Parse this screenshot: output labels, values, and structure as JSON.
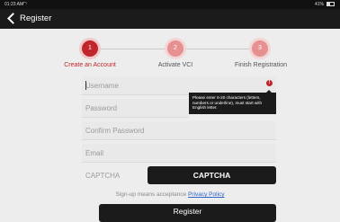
{
  "status_bar": {
    "time": "01:23 AM",
    "battery": "41%"
  },
  "nav": {
    "title": "Register"
  },
  "steps": [
    {
      "number": "1",
      "label": "Create an Account",
      "state": "active"
    },
    {
      "number": "2",
      "label": "Activate VCI",
      "state": "inactive"
    },
    {
      "number": "3",
      "label": "Finish Registration",
      "state": "inactive"
    }
  ],
  "form": {
    "username": {
      "placeholder": "Username",
      "value": ""
    },
    "password": {
      "placeholder": "Password",
      "value": ""
    },
    "confirm_password": {
      "placeholder": "Confirm Password",
      "value": ""
    },
    "email": {
      "placeholder": "Email",
      "value": ""
    },
    "captcha_label": "CAPTCHA",
    "captcha_button": "CAPTCHA",
    "error_icon": "!",
    "error_tooltip": "Please enter 6-20 characters (letters, numbers or underline), must start with English letter."
  },
  "agreement": {
    "text": "Sign-up means acceptance",
    "link": "Privacy Policy"
  },
  "register_button": "Register",
  "colors": {
    "accent": "#c0262b",
    "accent_light": "#e6908f",
    "dark": "#1b1b1b",
    "link": "#2d63c8"
  }
}
